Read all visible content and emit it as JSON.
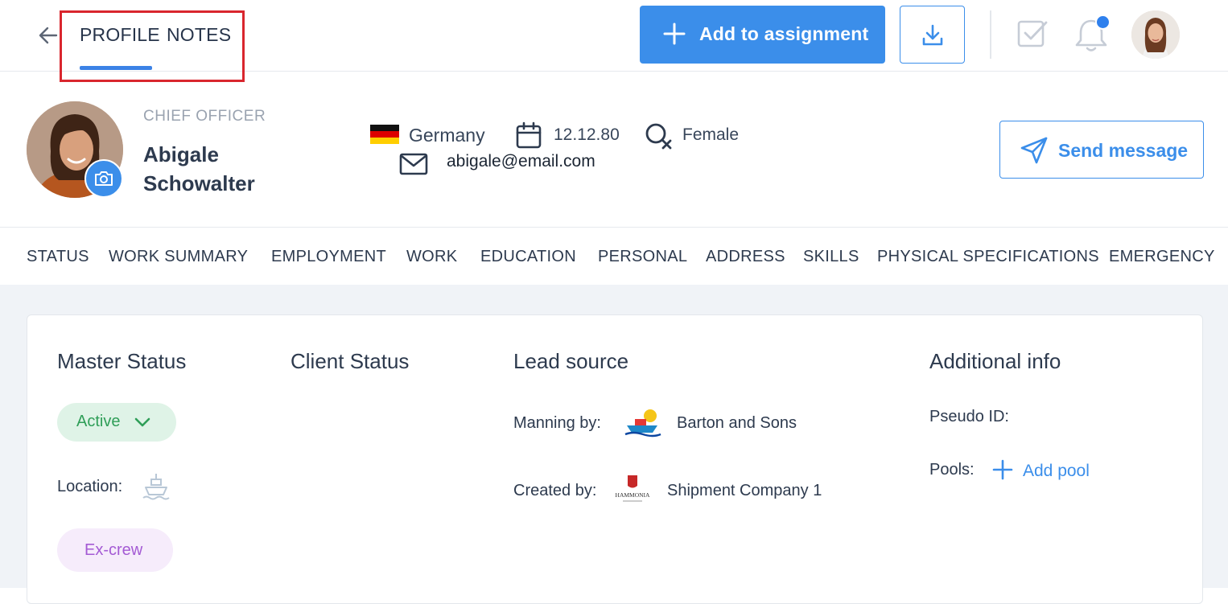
{
  "header": {
    "tabs": [
      {
        "label": "PROFILE",
        "active": true
      },
      {
        "label": "NOTES",
        "active": false
      }
    ],
    "add_to_assignment_label": "Add to assignment",
    "icons": {
      "back": "arrow-left-icon",
      "add": "plus-icon",
      "download": "download-icon",
      "tasks": "checkbox-icon",
      "notifications": "bell-icon"
    },
    "notification_dot_color": "#2f80ed",
    "accent_color": "#3b8eea"
  },
  "profile": {
    "rank": "CHIEF OFFICER",
    "name": "Abigale Schowalter",
    "country": "Germany",
    "date_of_birth": "12.12.80",
    "gender": "Female",
    "email": "abigale@email.com",
    "send_message_label": "Send message"
  },
  "sections": [
    "STATUS",
    "WORK SUMMARY",
    "EMPLOYMENT",
    "WORK",
    "EDUCATION",
    "PERSONAL",
    "ADDRESS",
    "SKILLS",
    "PHYSICAL SPECIFICATIONS",
    "EMERGENCY"
  ],
  "status": {
    "master_status": {
      "title": "Master Status",
      "value": "Active",
      "location_label": "Location:",
      "crew_tag": "Ex-crew"
    },
    "client_status": {
      "title": "Client Status"
    },
    "lead_source": {
      "title": "Lead source",
      "manning_label": "Manning by:",
      "manning_value": "Barton and Sons",
      "created_label": "Created by:",
      "created_value": "Shipment Company 1",
      "created_logo_text": "HAMMONIA"
    },
    "additional_info": {
      "title": "Additional info",
      "pseudo_id_label": "Pseudo ID:",
      "pools_label": "Pools:",
      "add_pool_label": "Add pool"
    }
  }
}
